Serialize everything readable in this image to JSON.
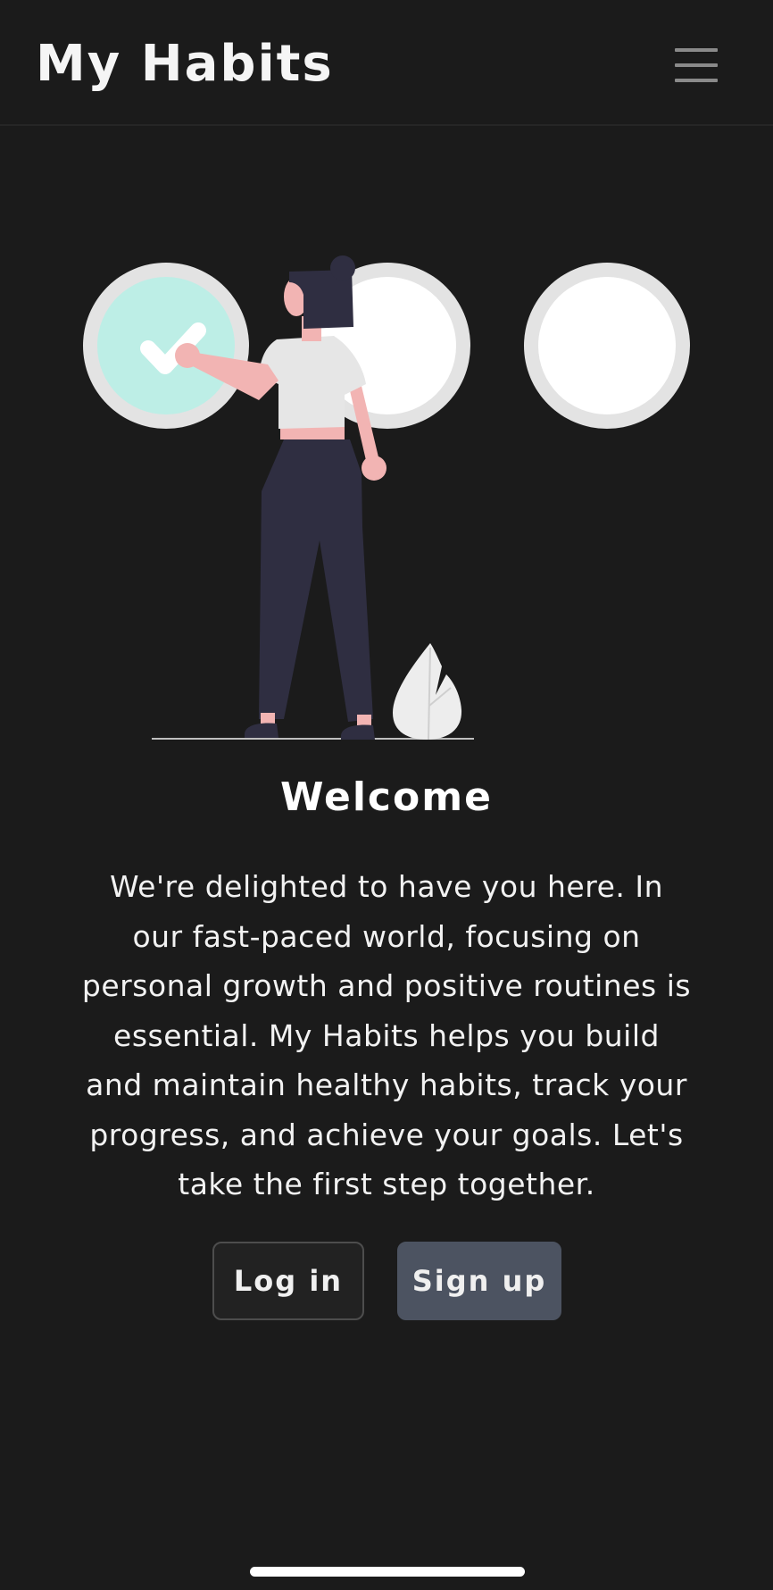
{
  "header": {
    "app_title": "My Habits",
    "menu_icon": "hamburger-menu-icon"
  },
  "welcome": {
    "title": "Welcome",
    "description": "We're delighted to have you here. In our fast-paced world, focusing on personal growth and positive routines is essential. My Habits helps you build and maintain healthy habits, track your progress, and achieve your goals. Let's take the first step together."
  },
  "actions": {
    "login_label": "Log in",
    "signup_label": "Sign up"
  },
  "colors": {
    "background": "#1b1b1b",
    "check_circle_fill": "#bdeee6",
    "signup_button": "#4c5361"
  }
}
